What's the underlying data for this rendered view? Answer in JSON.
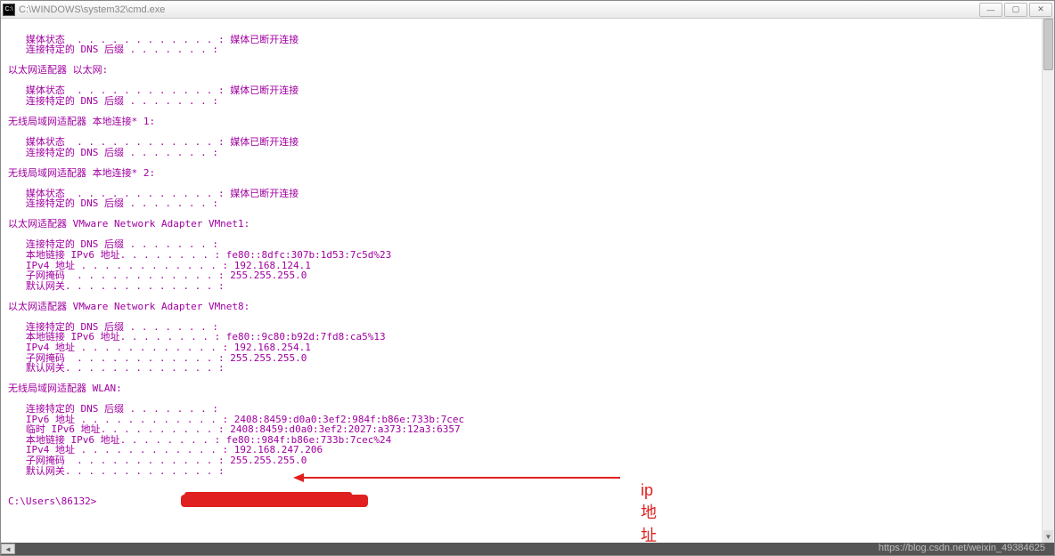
{
  "window": {
    "title": "C:\\WINDOWS\\system32\\cmd.exe",
    "icon_text": "C:\\"
  },
  "terminal_lines": [
    "",
    "   媒体状态  . . . . . . . . . . . . : 媒体已断开连接",
    "   连接特定的 DNS 后缀 . . . . . . . :",
    "",
    "以太网适配器 以太网:",
    "",
    "   媒体状态  . . . . . . . . . . . . : 媒体已断开连接",
    "   连接特定的 DNS 后缀 . . . . . . . :",
    "",
    "无线局域网适配器 本地连接* 1:",
    "",
    "   媒体状态  . . . . . . . . . . . . : 媒体已断开连接",
    "   连接特定的 DNS 后缀 . . . . . . . :",
    "",
    "无线局域网适配器 本地连接* 2:",
    "",
    "   媒体状态  . . . . . . . . . . . . : 媒体已断开连接",
    "   连接特定的 DNS 后缀 . . . . . . . :",
    "",
    "以太网适配器 VMware Network Adapter VMnet1:",
    "",
    "   连接特定的 DNS 后缀 . . . . . . . :",
    "   本地链接 IPv6 地址. . . . . . . . : fe80::8dfc:307b:1d53:7c5d%23",
    "   IPv4 地址 . . . . . . . . . . . . : 192.168.124.1",
    "   子网掩码  . . . . . . . . . . . . : 255.255.255.0",
    "   默认网关. . . . . . . . . . . . . :",
    "",
    "以太网适配器 VMware Network Adapter VMnet8:",
    "",
    "   连接特定的 DNS 后缀 . . . . . . . :",
    "   本地链接 IPv6 地址. . . . . . . . : fe80::9c80:b92d:7fd8:ca5%13",
    "   IPv4 地址 . . . . . . . . . . . . : 192.168.254.1",
    "   子网掩码  . . . . . . . . . . . . : 255.255.255.0",
    "   默认网关. . . . . . . . . . . . . :",
    "",
    "无线局域网适配器 WLAN:",
    "",
    "   连接特定的 DNS 后缀 . . . . . . . :",
    "   IPv6 地址 . . . . . . . . . . . . : 2408:8459:d0a0:3ef2:984f:b86e:733b:7cec",
    "   临时 IPv6 地址. . . . . . . . . . : 2408:8459:d0a0:3ef2:2027:a373:12a3:6357",
    "   本地链接 IPv6 地址. . . . . . . . : fe80::984f:b86e:733b:7cec%24",
    "   IPv4 地址 . . . . . . . . . . . . : 192.168.247.206",
    "   子网掩码  . . . . . . . . . . . . : 255.255.255.0",
    "   默认网关. . . . . . . . . . . . . :",
    "",
    "",
    "C:\\Users\\86132>"
  ],
  "annotation": {
    "label": "ip地址"
  },
  "watermark": "https://blog.csdn.net/weixin_49384625"
}
